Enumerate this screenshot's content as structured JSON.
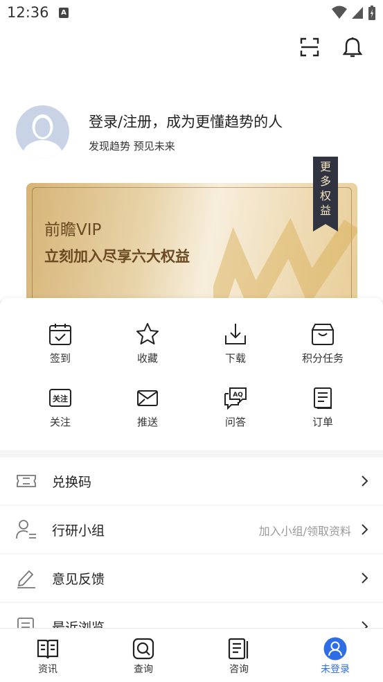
{
  "status_bar": {
    "time": "12:36",
    "a_badge": "A"
  },
  "header": {
    "login_title": "登录/注册，成为更懂趋势的人",
    "login_subtitle": "发现趋势 预见未来"
  },
  "vip_card": {
    "title": "前瞻VIP",
    "subtitle": "立刻加入尽享六大权益",
    "more_tag": [
      "更",
      "多",
      "权",
      "益"
    ]
  },
  "grid": [
    {
      "label": "签到",
      "icon": "calendar-check-icon"
    },
    {
      "label": "收藏",
      "icon": "star-icon"
    },
    {
      "label": "下载",
      "icon": "download-icon"
    },
    {
      "label": "积分任务",
      "icon": "points-task-icon"
    },
    {
      "label": "关注",
      "icon": "follow-icon",
      "badge": "关注"
    },
    {
      "label": "推送",
      "icon": "envelope-icon"
    },
    {
      "label": "问答",
      "icon": "qa-icon",
      "badge": "AQ"
    },
    {
      "label": "订单",
      "icon": "order-icon"
    }
  ],
  "list": [
    {
      "label": "兑换码",
      "hint": "",
      "icon": "ticket-icon"
    },
    {
      "label": "行研小组",
      "hint": "加入小组/领取资料",
      "icon": "user-group-icon"
    },
    {
      "label": "意见反馈",
      "hint": "",
      "icon": "pencil-icon"
    },
    {
      "label": "最近浏览",
      "hint": "",
      "icon": "history-icon"
    }
  ],
  "tabs": [
    {
      "label": "资讯",
      "icon": "book-icon",
      "active": false
    },
    {
      "label": "查询",
      "icon": "search-icon",
      "active": false
    },
    {
      "label": "咨询",
      "icon": "report-icon",
      "active": false
    },
    {
      "label": "未登录",
      "icon": "user-icon",
      "active": true
    }
  ],
  "colors": {
    "accent": "#2f6de6",
    "vip_text": "#6b4a23",
    "vip_tag_bg": "#2f3440"
  }
}
